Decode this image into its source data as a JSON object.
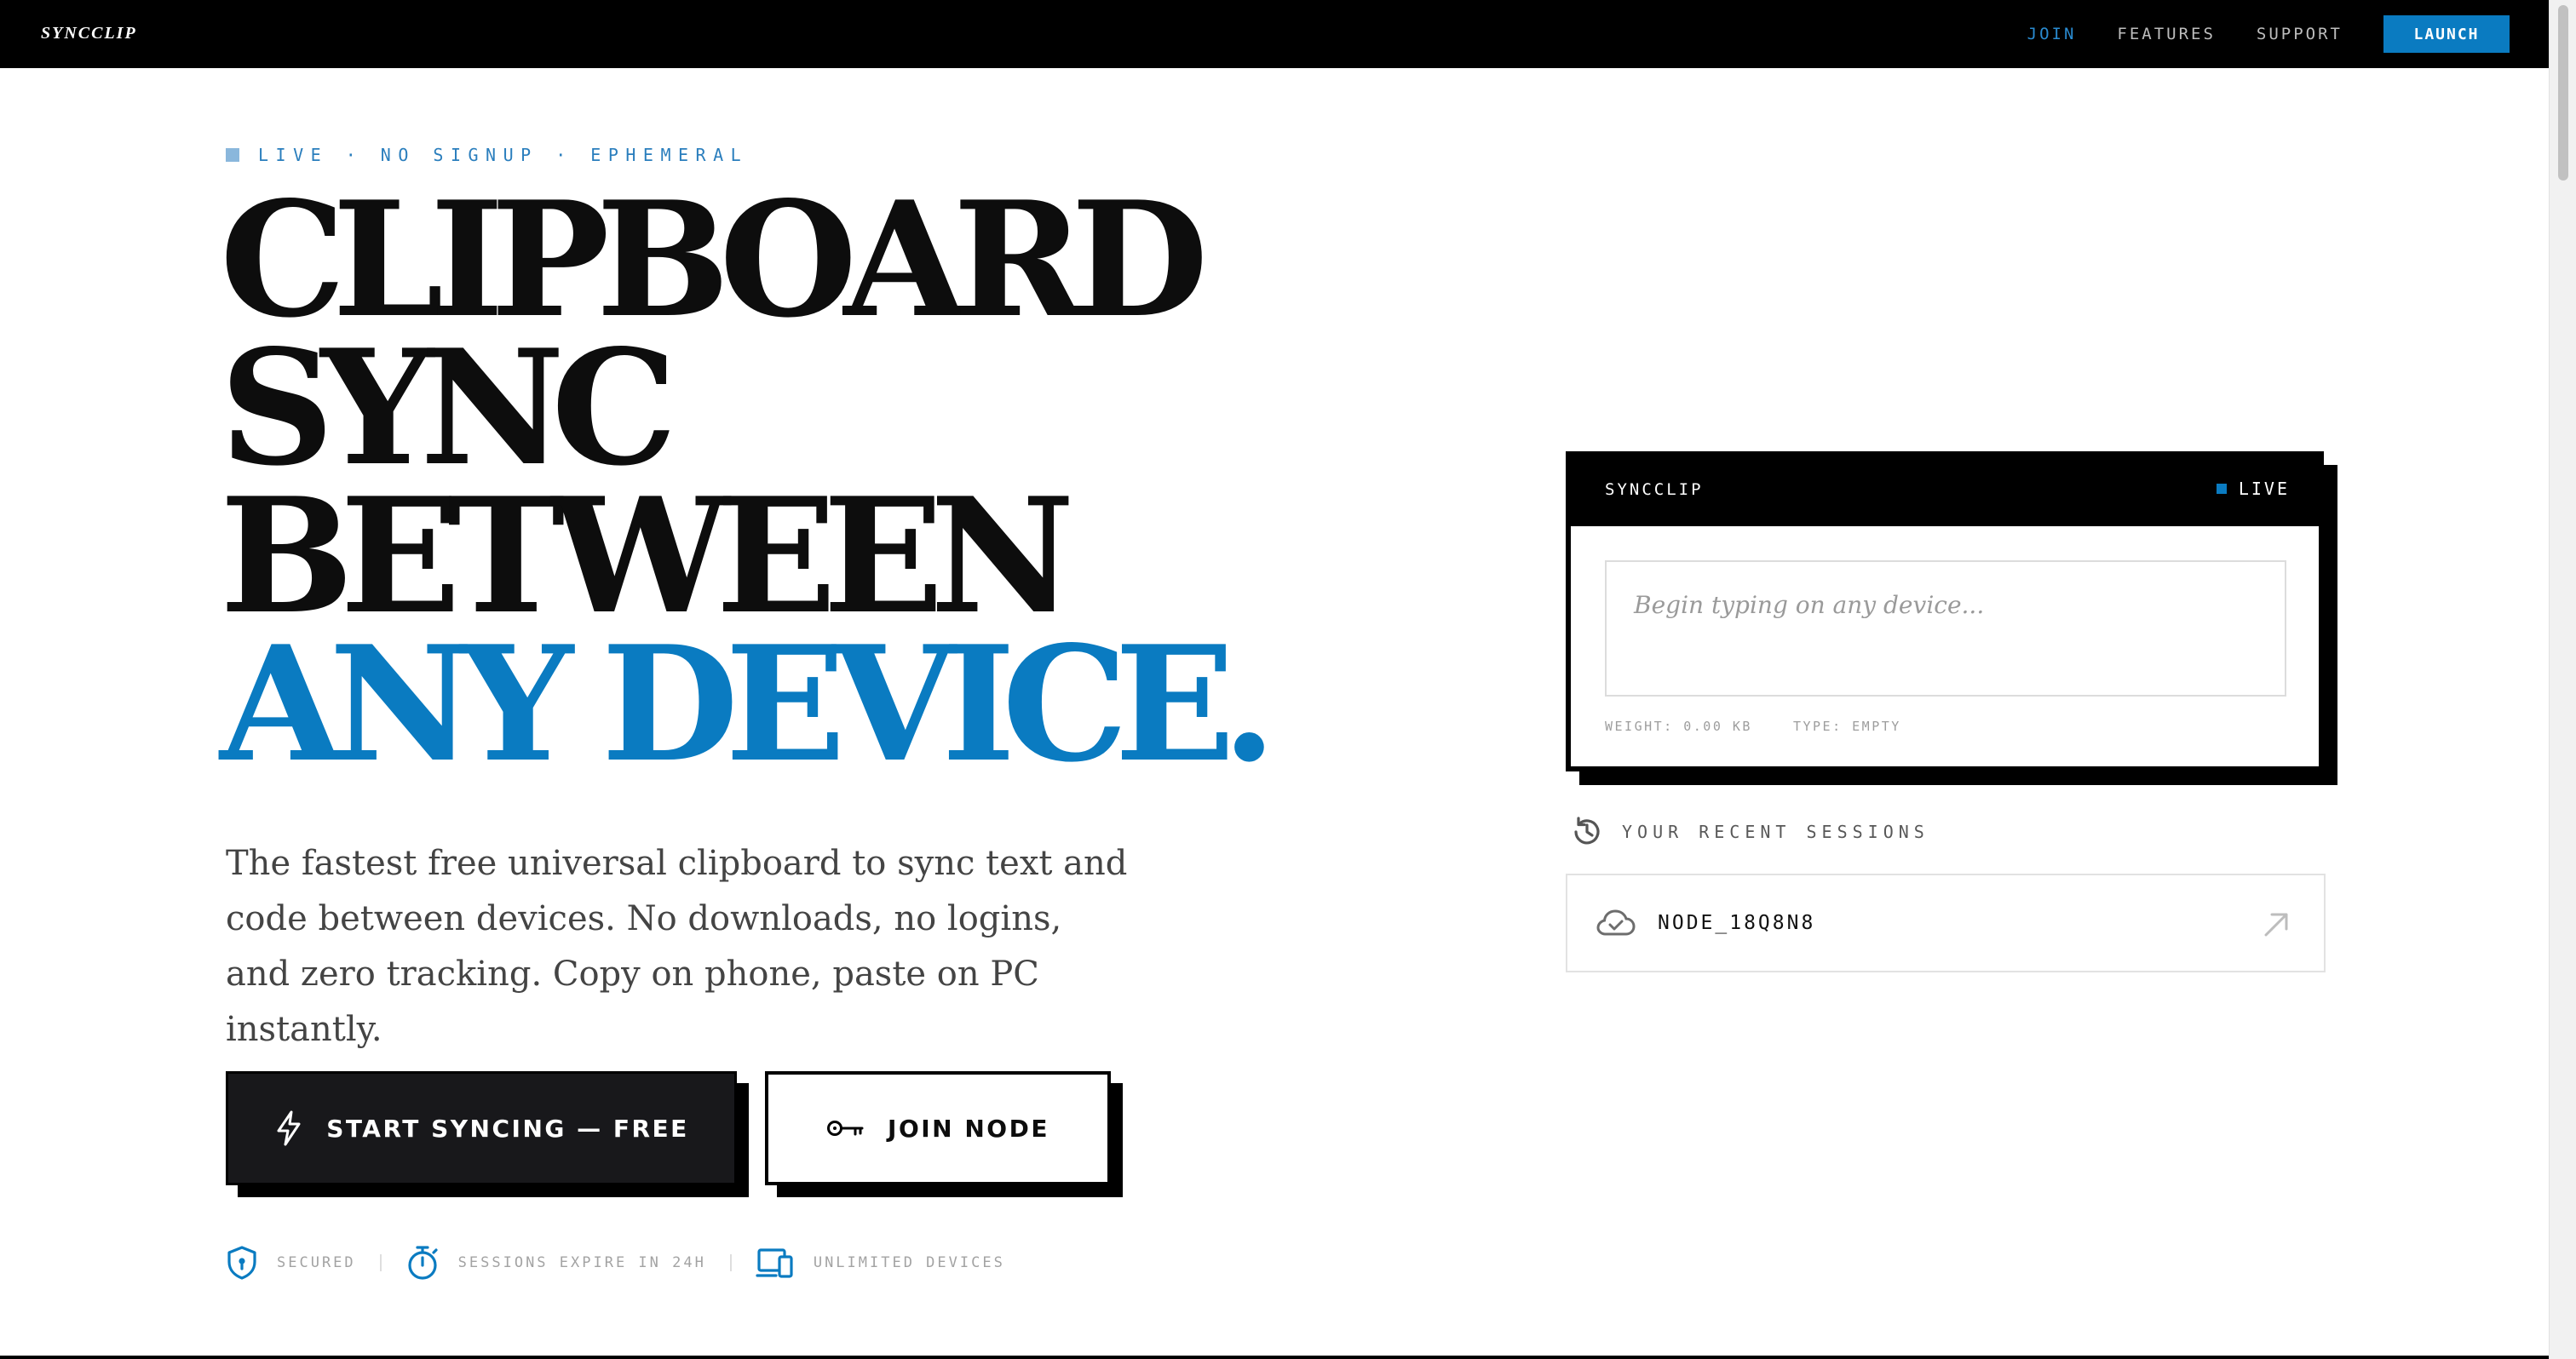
{
  "nav": {
    "brand": "SYNCCLIP",
    "links": [
      {
        "label": "JOIN",
        "active": true
      },
      {
        "label": "FEATURES",
        "active": false
      },
      {
        "label": "SUPPORT",
        "active": false
      }
    ],
    "launch_label": "LAUNCH"
  },
  "hero": {
    "tagline": "LIVE · NO SIGNUP · EPHEMERAL",
    "headline": {
      "line1": "CLIPBOARD",
      "line2": "SYNC",
      "line3": "BETWEEN",
      "line4": "ANY DEVICE."
    },
    "description": "The fastest free universal clipboard to sync text and code between devices. No downloads, no logins, and zero tracking. Copy on phone, paste on PC instantly.",
    "primary_cta": {
      "label": "START SYNCING — FREE",
      "icon": "lightning-icon"
    },
    "secondary_cta": {
      "label": "JOIN NODE",
      "icon": "key-icon"
    },
    "badges": [
      {
        "label": "SECURED",
        "icon": "shield-icon"
      },
      {
        "label": "SESSIONS EXPIRE IN 24H",
        "icon": "stopwatch-icon"
      },
      {
        "label": "UNLIMITED DEVICES",
        "icon": "devices-icon"
      }
    ]
  },
  "widget": {
    "title": "SYNCCLIP",
    "status": "LIVE",
    "input_placeholder": "Begin typing on any device...",
    "input_value": "",
    "weight_label": "WEIGHT: 0.00 KB",
    "type_label": "TYPE: EMPTY"
  },
  "recent": {
    "title": "YOUR RECENT SESSIONS",
    "icon": "history-icon",
    "sessions": [
      {
        "name": "NODE_18Q8N8",
        "icon": "cloud-check-icon",
        "action_icon": "arrow-up-right-icon"
      }
    ]
  },
  "colors": {
    "accent": "#0a7bc1",
    "nav_bg": "#000000",
    "tag_square": "#8ab7dc",
    "primary_button_bg": "#18181b"
  }
}
